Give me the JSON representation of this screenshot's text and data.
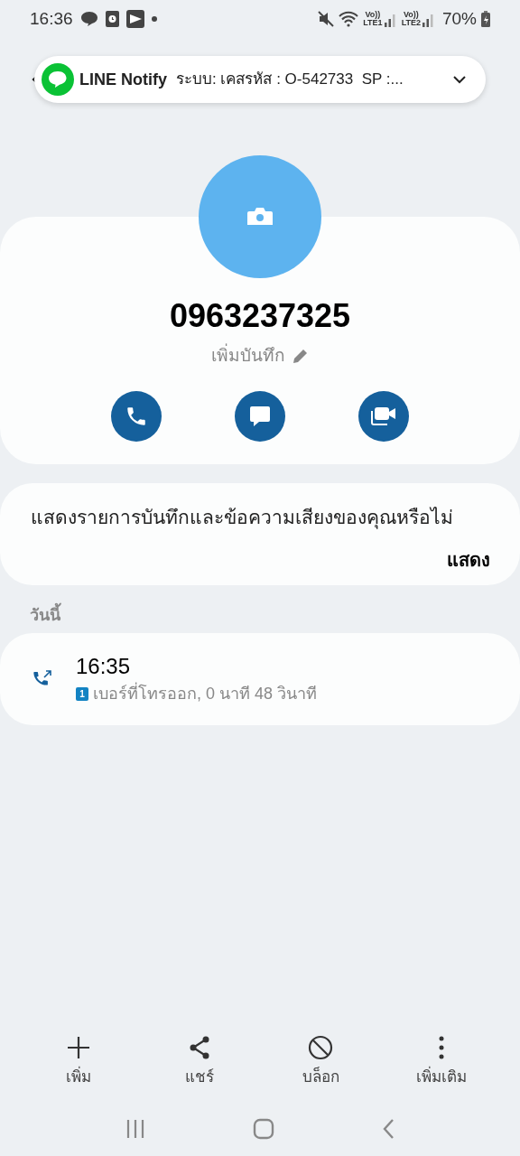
{
  "status_bar": {
    "time": "16:36",
    "sim1": [
      "Vo))",
      "LTE1"
    ],
    "sim2": [
      "Vo))",
      "LTE2"
    ],
    "battery": "70%"
  },
  "notification": {
    "app": "LINE Notify",
    "text": "ระบบ: เคสรหัส : O-542733  SP :..."
  },
  "contact": {
    "number": "0963237325",
    "note": "เพิ่มบันทึก"
  },
  "prompt": {
    "text": "แสดงรายการบันทึกและข้อความเสียงของคุณหรือไม่",
    "action": "แสดง"
  },
  "section": "วันนี้",
  "calls": [
    {
      "time": "16:35",
      "sim": "1",
      "detail": "เบอร์ที่โทรออก, 0 นาที 48 วินาที"
    }
  ],
  "actions": [
    {
      "kind": "add",
      "label": "เพิ่ม"
    },
    {
      "kind": "share",
      "label": "แชร์"
    },
    {
      "kind": "block",
      "label": "บล็อก"
    },
    {
      "kind": "more",
      "label": "เพิ่มเติม"
    }
  ]
}
